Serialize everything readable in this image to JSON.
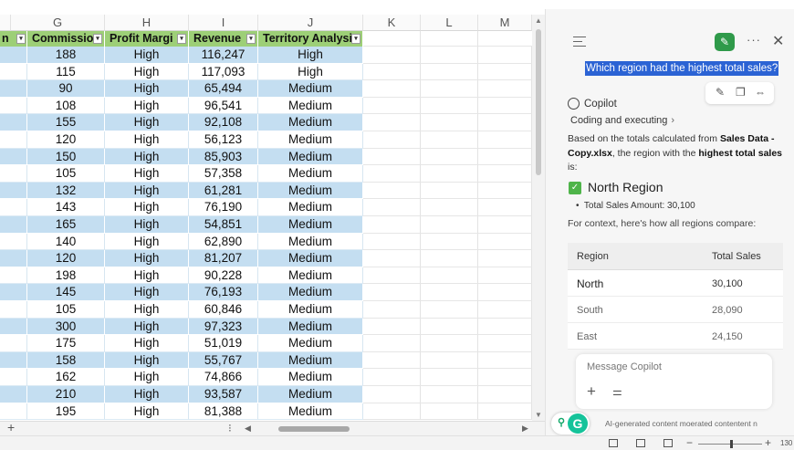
{
  "sheet": {
    "col_letters": [
      "G",
      "H",
      "I",
      "J",
      "K",
      "L",
      "M"
    ],
    "headers": [
      "n",
      "Commissio",
      "Profit Margi",
      "Revenue",
      "Territory Analysi"
    ],
    "rows": [
      [
        "188",
        "High",
        "116,247",
        "High"
      ],
      [
        "115",
        "High",
        "117,093",
        "High"
      ],
      [
        "90",
        "High",
        "65,494",
        "Medium"
      ],
      [
        "108",
        "High",
        "96,541",
        "Medium"
      ],
      [
        "155",
        "High",
        "92,108",
        "Medium"
      ],
      [
        "120",
        "High",
        "56,123",
        "Medium"
      ],
      [
        "150",
        "High",
        "85,903",
        "Medium"
      ],
      [
        "105",
        "High",
        "57,358",
        "Medium"
      ],
      [
        "132",
        "High",
        "61,281",
        "Medium"
      ],
      [
        "143",
        "High",
        "76,190",
        "Medium"
      ],
      [
        "165",
        "High",
        "54,851",
        "Medium"
      ],
      [
        "140",
        "High",
        "62,890",
        "Medium"
      ],
      [
        "120",
        "High",
        "81,207",
        "Medium"
      ],
      [
        "198",
        "High",
        "90,228",
        "Medium"
      ],
      [
        "145",
        "High",
        "76,193",
        "Medium"
      ],
      [
        "105",
        "High",
        "60,846",
        "Medium"
      ],
      [
        "300",
        "High",
        "97,323",
        "Medium"
      ],
      [
        "175",
        "High",
        "51,019",
        "Medium"
      ],
      [
        "158",
        "High",
        "55,767",
        "Medium"
      ],
      [
        "162",
        "High",
        "74,866",
        "Medium"
      ],
      [
        "210",
        "High",
        "93,587",
        "Medium"
      ],
      [
        "195",
        "High",
        "81,388",
        "Medium"
      ]
    ],
    "add_sheet": "+",
    "band_color": "#c4def1",
    "header_color": "#9dcf77"
  },
  "copilot": {
    "user_message": "Which region had the highest total sales?",
    "name": "Copilot",
    "coding_label": "Coding and executing",
    "answer_intro_1": "Based on the totals calculated from ",
    "answer_file": "Sales Data - Copy.xlsx",
    "answer_intro_2": ", the region with the ",
    "answer_emph": "highest total sales",
    "answer_intro_3": " is:",
    "result_title": "North Region",
    "bullet": "Total Sales Amount: 30,100",
    "context_line": "For context, here's how all regions compare:",
    "table_headers": [
      "Region",
      "Total Sales"
    ],
    "table_rows": [
      [
        "North",
        "30,100"
      ],
      [
        "South",
        "28,090"
      ],
      [
        "East",
        "24,150"
      ]
    ],
    "composer_placeholder": "Message Copilot",
    "disclaimer": "AI-generated content moerated contentent n",
    "accent": "#2f9a4a"
  },
  "status": {
    "zoom_level": "130"
  },
  "icons": [
    "menu-icon",
    "new-chat-icon",
    "more-icon",
    "close-icon",
    "edit-icon",
    "copy-icon",
    "share-icon",
    "copilot-icon",
    "chevron-right-icon",
    "check-icon",
    "plus-icon",
    "settings-sliders-icon",
    "grammarly-icon"
  ]
}
